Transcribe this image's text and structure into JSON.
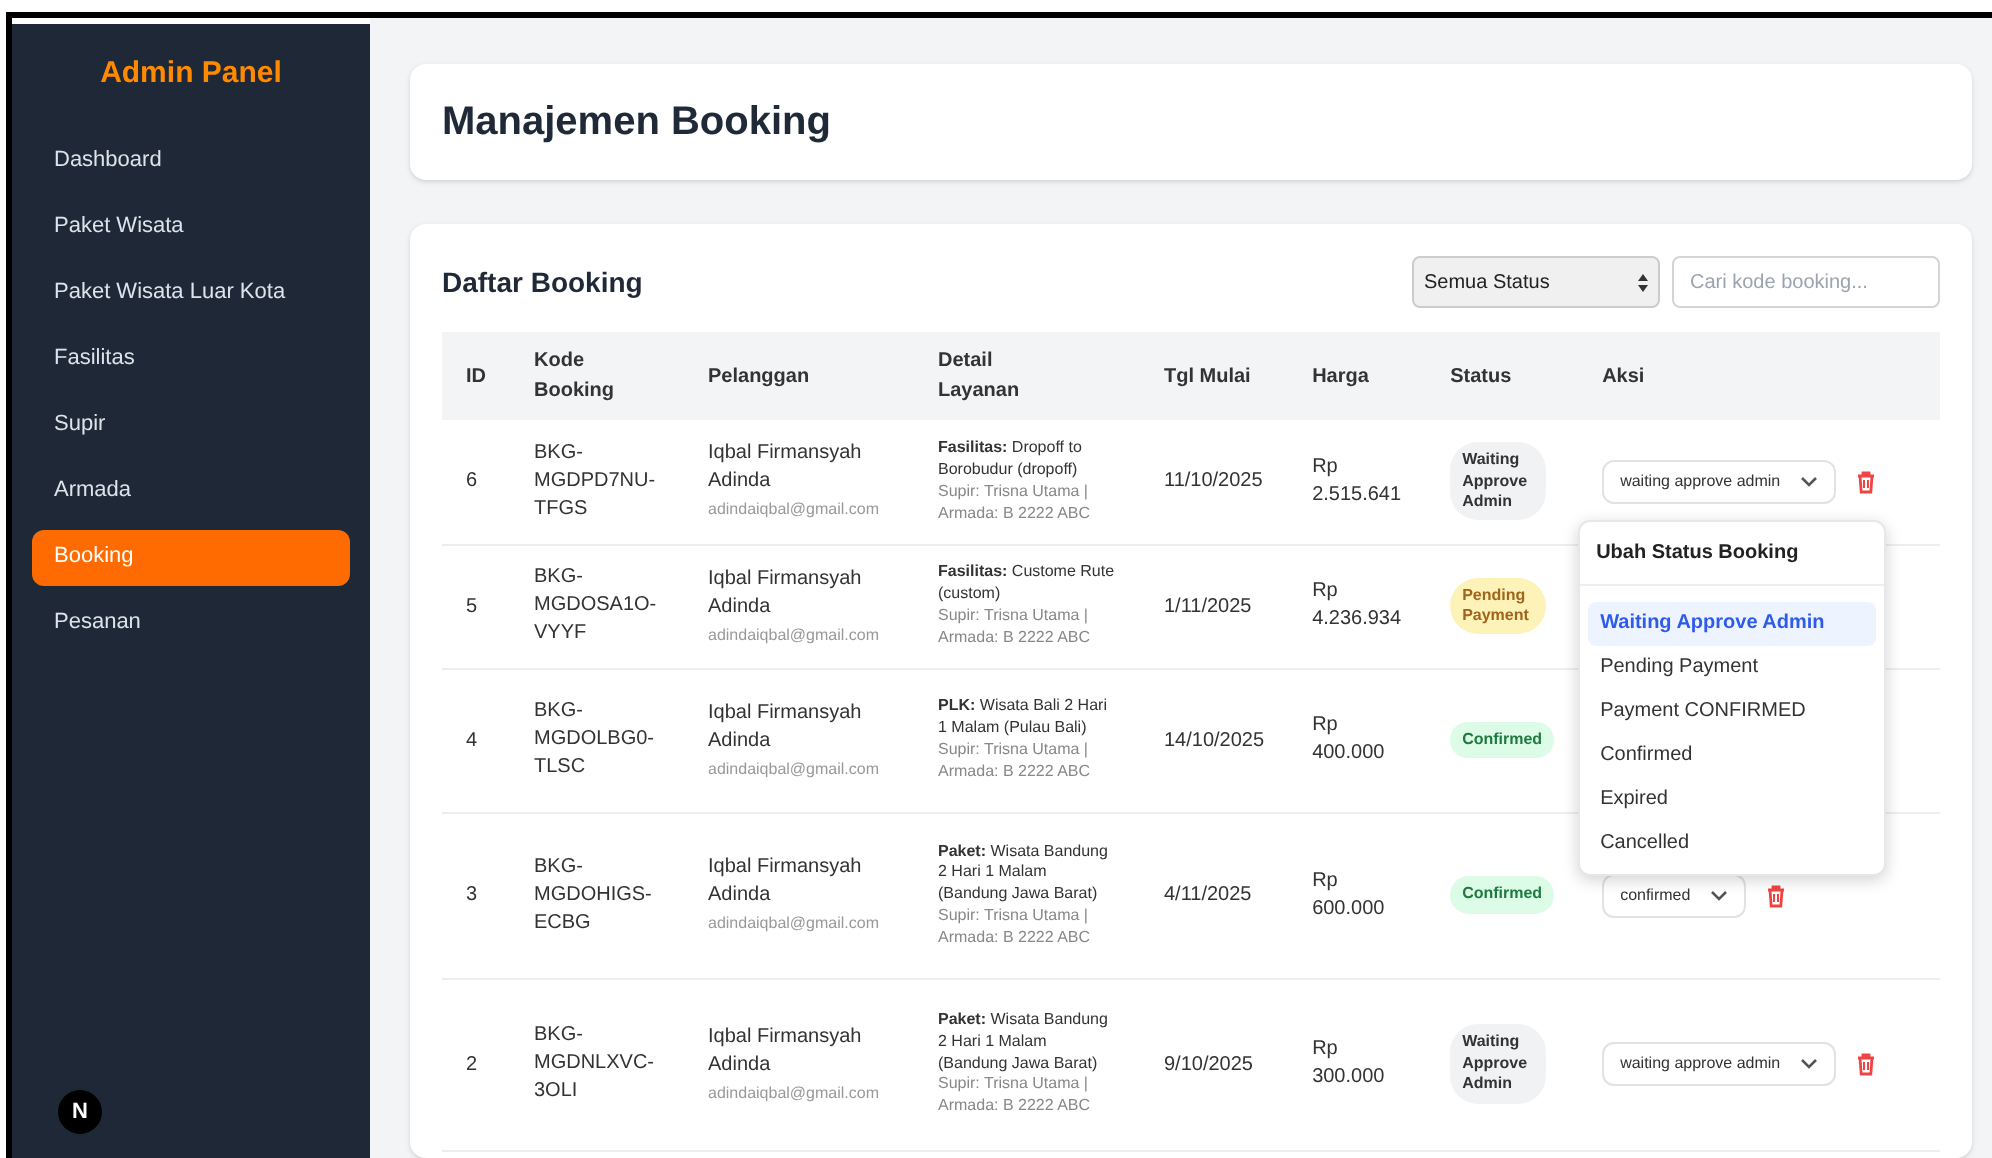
{
  "sidebar": {
    "title": "Admin Panel",
    "items": [
      {
        "label": "Dashboard",
        "selected": false
      },
      {
        "label": "Paket Wisata",
        "selected": false
      },
      {
        "label": "Paket Wisata Luar Kota",
        "selected": false
      },
      {
        "label": "Fasilitas",
        "selected": false
      },
      {
        "label": "Supir",
        "selected": false
      },
      {
        "label": "Armada",
        "selected": false
      },
      {
        "label": "Booking",
        "selected": true
      },
      {
        "label": "Pesanan",
        "selected": false
      }
    ],
    "dev_indicator": "N"
  },
  "page_title": "Manajemen Booking",
  "list": {
    "title": "Daftar Booking",
    "status_filter": "Semua Status",
    "search": {
      "placeholder": "Cari kode booking..."
    },
    "columns": [
      "ID",
      "Kode Booking",
      "Pelanggan",
      "Detail Layanan",
      "Tgl Mulai",
      "Harga",
      "Status",
      "Aksi"
    ],
    "rows": [
      {
        "id": "6",
        "code": "BKG-MGDPD7NU-TFGS",
        "name": "Iqbal Firmansyah Adinda",
        "email": "adindaiqbal@gmail.com",
        "detail": "**Fasilitas:** Dropoff to Borobudur (dropoff)",
        "crew": "Supir: Trisna Utama | Armada: B 2222 ABC",
        "date": "11/10/2025",
        "price": "Rp 2.515.641",
        "status": {
          "kind": "waiting",
          "label": "Waiting Approve Admin"
        },
        "action": "waiting approve admin",
        "menu_open": true
      },
      {
        "id": "5",
        "code": "BKG-MGDOSA1O-VYYF",
        "name": "Iqbal Firmansyah Adinda",
        "email": "adindaiqbal@gmail.com",
        "detail": "**Fasilitas:** Custome Rute (custom)",
        "crew": "Supir: Trisna Utama | Armada: B 2222 ABC",
        "date": "1/11/2025",
        "price": "Rp 4.236.934",
        "status": {
          "kind": "pending",
          "label": "Pending Payment"
        },
        "menu_open": false
      },
      {
        "id": "4",
        "code": "BKG-MGDOLBG0-TLSC",
        "name": "Iqbal Firmansyah Adinda",
        "email": "adindaiqbal@gmail.com",
        "detail": "**PLK:** Wisata Bali 2 Hari 1 Malam (Pulau Bali)",
        "crew": "Supir: Trisna Utama | Armada: B 2222 ABC",
        "date": "14/10/2025",
        "price": "Rp 400.000",
        "status": {
          "kind": "confirmed",
          "label": "Confirmed"
        },
        "menu_open": false
      },
      {
        "id": "3",
        "code": "BKG-MGDOHIGS-ECBG",
        "name": "Iqbal Firmansyah Adinda",
        "email": "adindaiqbal@gmail.com",
        "detail": "**Paket:** Wisata Bandung 2 Hari 1 Malam (Bandung Jawa Barat)",
        "crew": "Supir: Trisna Utama | Armada: B 2222 ABC",
        "date": "4/11/2025",
        "price": "Rp 600.000",
        "status": {
          "kind": "confirmed",
          "label": "Confirmed"
        },
        "action": "confirmed",
        "menu_open": false
      },
      {
        "id": "2",
        "code": "BKG-MGDNLXVC-3OLI",
        "name": "Iqbal Firmansyah Adinda",
        "email": "adindaiqbal@gmail.com",
        "detail": "**Paket:** Wisata Bandung 2 Hari 1 Malam (Bandung Jawa Barat)",
        "crew": "Supir: Trisna Utama | Armada: B 2222 ABC",
        "date": "9/10/2025",
        "price": "Rp 300.000",
        "status": {
          "kind": "waiting",
          "label": "Waiting Approve Admin"
        },
        "action": "waiting approve admin",
        "menu_open": false
      }
    ],
    "status_menu": {
      "title": "Ubah Status Booking",
      "options": [
        {
          "label": "Waiting Approve Admin",
          "selected": true
        },
        {
          "label": "Pending Payment",
          "selected": false
        },
        {
          "label": "Payment CONFIRMED",
          "selected": false
        },
        {
          "label": "Confirmed",
          "selected": false
        },
        {
          "label": "Expired",
          "selected": false
        },
        {
          "label": "Cancelled",
          "selected": false
        }
      ]
    }
  }
}
